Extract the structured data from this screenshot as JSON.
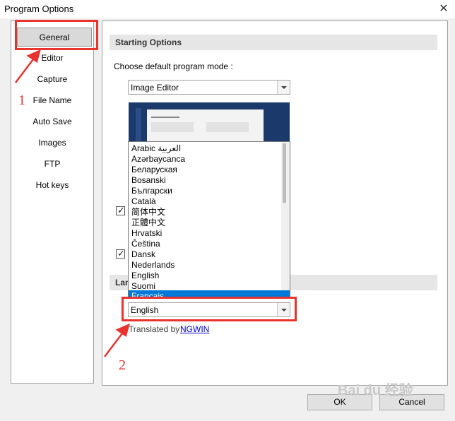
{
  "window": {
    "title": "Program Options",
    "close_glyph": "✕"
  },
  "sidebar": {
    "items": [
      {
        "label": "General",
        "selected": true
      },
      {
        "label": "Editor"
      },
      {
        "label": "Capture"
      },
      {
        "label": "File Name"
      },
      {
        "label": "Auto Save"
      },
      {
        "label": "Images"
      },
      {
        "label": "FTP"
      },
      {
        "label": "Hot keys"
      }
    ]
  },
  "starting_options": {
    "header": "Starting Options",
    "mode_label": "Choose default program mode :",
    "mode_value": "Image Editor"
  },
  "language_list": {
    "items": [
      "Arabic العربية",
      "Azərbaycanca",
      "Беларуская",
      "Bosanski",
      "Български",
      "Català",
      "简体中文",
      "正體中文",
      "Hrvatski",
      "Čeština",
      "Dansk",
      "Nederlands",
      "English",
      "Suomi",
      "Français"
    ],
    "highlighted": "Français"
  },
  "language": {
    "header_partial": "Lan",
    "value": "English",
    "translated_by": "Translated by",
    "translator": "NGWIN"
  },
  "buttons": {
    "ok": "OK",
    "cancel": "Cancel"
  },
  "annotations": {
    "step1": "1",
    "step2": "2"
  },
  "watermark": "Bai du 经验",
  "colors": {
    "highlight_box": "#e8332f",
    "selection": "#0078d7",
    "preview_bg": "#1b3a6b"
  }
}
